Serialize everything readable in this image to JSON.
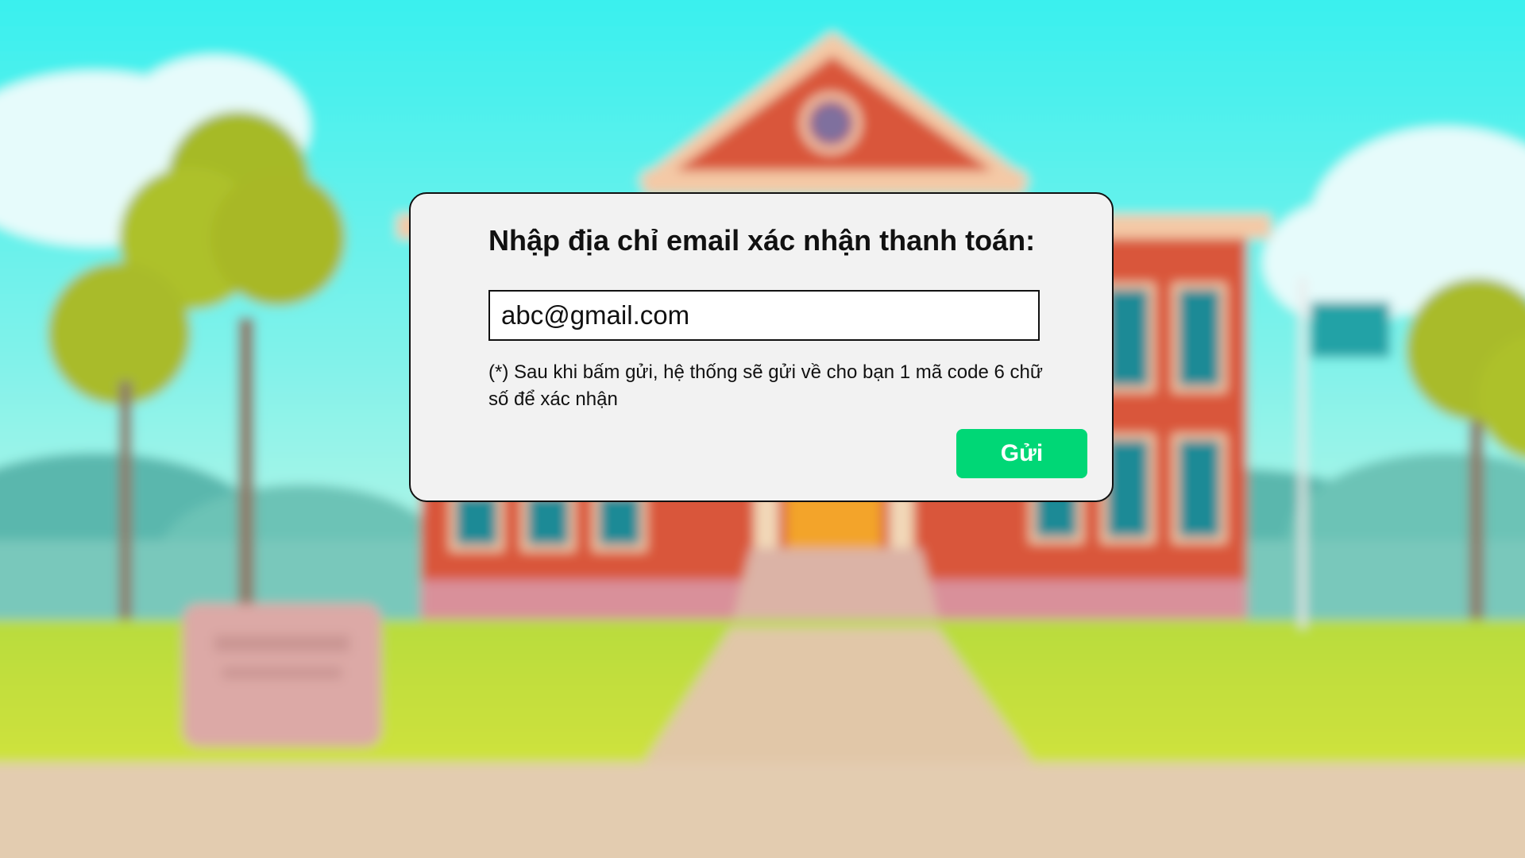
{
  "dialog": {
    "title": "Nhập địa chỉ email xác nhận thanh toán:",
    "email_value": "abc@gmail.com",
    "hint": "(*) Sau khi bấm gửi, hệ thống sẽ gửi về cho bạn 1 mã code 6 chữ số để xác nhận",
    "send_label": "Gửi"
  },
  "colors": {
    "sky": "#3ef0ec",
    "grass": "#c4df3a",
    "building": "#d9573a",
    "send_button": "#00d776",
    "dialog_background": "#f2f2f2"
  }
}
